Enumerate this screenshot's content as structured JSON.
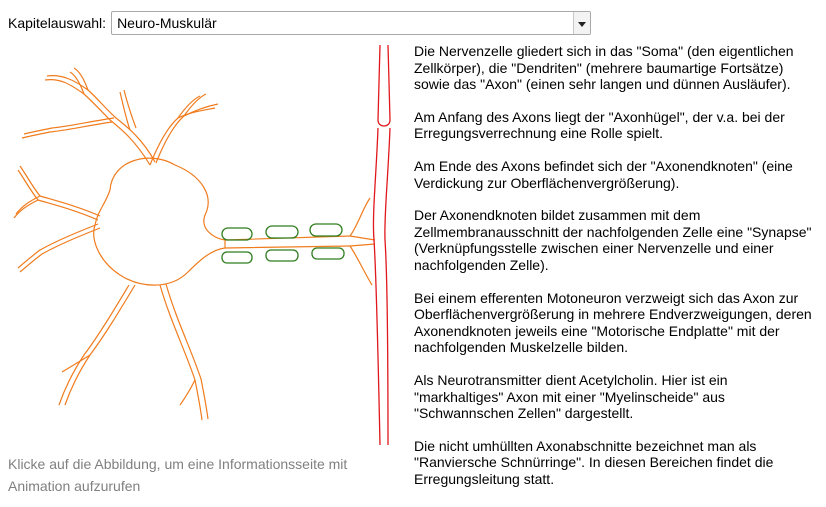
{
  "chapter": {
    "label": "Kapitelauswahl:",
    "selected": "Neuro-Muskulär"
  },
  "hint": {
    "text": "Klicke auf die Abbildung, um eine Informationsseite mit Animation aufzurufen"
  },
  "info": {
    "paragraphs": [
      "Die Nervenzelle gliedert sich in das \"Soma\" (den eigentlichen Zellkörper), die \"Dendriten\" (mehrere baumartige Fortsätze) sowie das \"Axon\" (einen sehr langen und dünnen Ausläufer).",
      "Am Anfang des Axons liegt der \"Axonhügel\", der v.a. bei der Erregungsverrechnung eine Rolle spielt.",
      "Am Ende des Axons befindet sich der \"Axonendknoten\" (eine Verdickung zur Oberflächenvergrößerung).",
      "Der Axonendknoten bildet zusammen mit dem Zellmembranausschnitt der nachfolgenden Zelle eine \"Synapse\" (Verknüpfungsstelle zwischen einer Nervenzelle und einer nachfolgenden Zelle).",
      "Bei einem efferenten Motoneuron verzweigt sich das Axon zur Oberflächenvergrößerung in mehrere Endverzweigungen, deren Axonendknoten jeweils eine \"Motorische Endplatte\" mit der nachfolgenden Muskelzelle bilden.",
      "Als Neurotransmitter dient Acetylcholin. Hier ist ein \"markhaltiges\" Axon mit einer \"Myelinscheide\" aus \"Schwannschen Zellen\" dargestellt.",
      "Die nicht umhüllten Axonabschnitte bezeichnet man als \"Ranviersche Schnürringe\". In diesen Bereichen findet die Erregungsleitung statt."
    ]
  },
  "colors": {
    "neuron": "#f07c1e",
    "myelin": "#2f7d1e",
    "muscle": "#e0181c"
  }
}
